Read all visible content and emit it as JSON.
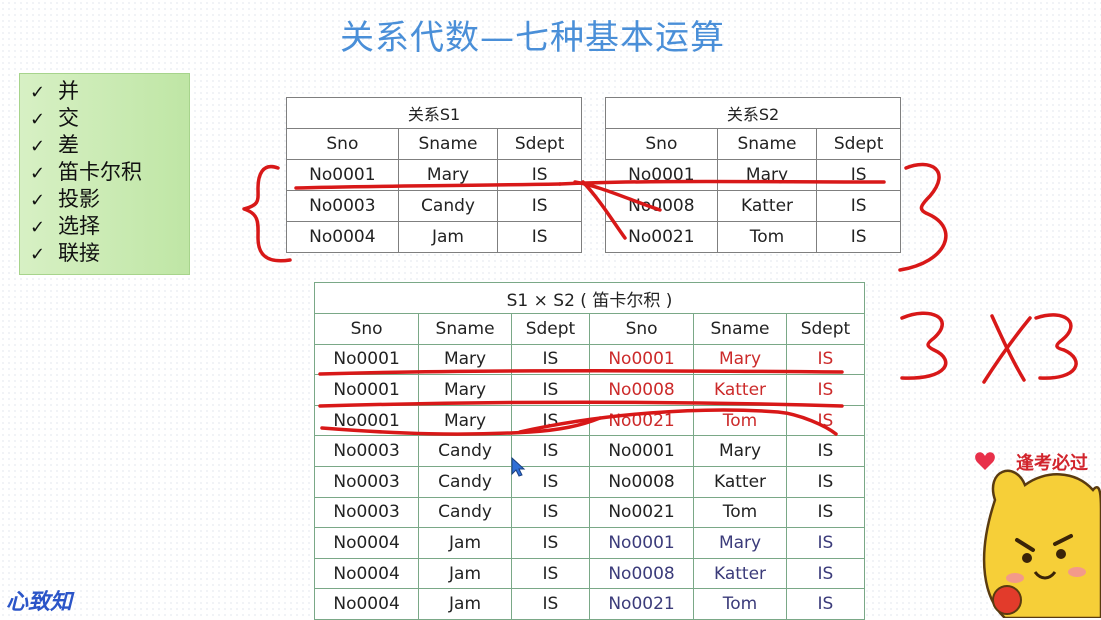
{
  "title": "关系代数—七种基本运算",
  "operations": [
    "并",
    "交",
    "差",
    "笛卡尔积",
    "投影",
    "选择",
    "联接"
  ],
  "s1": {
    "caption": "关系S1",
    "headers": [
      "Sno",
      "Sname",
      "Sdept"
    ],
    "rows": [
      [
        "No0001",
        "Mary",
        "IS"
      ],
      [
        "No0003",
        "Candy",
        "IS"
      ],
      [
        "No0004",
        "Jam",
        "IS"
      ]
    ]
  },
  "s2": {
    "caption": "关系S2",
    "headers": [
      "Sno",
      "Sname",
      "Sdept"
    ],
    "rows": [
      [
        "No0001",
        "Mary",
        "IS"
      ],
      [
        "No0008",
        "Katter",
        "IS"
      ],
      [
        "No0021",
        "Tom",
        "IS"
      ]
    ]
  },
  "product": {
    "caption": "S1 × S2 ( 笛卡尔积 )",
    "headers": [
      "Sno",
      "Sname",
      "Sdept",
      "Sno",
      "Sname",
      "Sdept"
    ],
    "rows": [
      [
        "No0001",
        "Mary",
        "IS",
        "No0001",
        "Mary",
        "IS"
      ],
      [
        "No0001",
        "Mary",
        "IS",
        "No0008",
        "Katter",
        "IS"
      ],
      [
        "No0001",
        "Mary",
        "IS",
        "No0021",
        "Tom",
        "IS"
      ],
      [
        "No0003",
        "Candy",
        "IS",
        "No0001",
        "Mary",
        "IS"
      ],
      [
        "No0003",
        "Candy",
        "IS",
        "No0008",
        "Katter",
        "IS"
      ],
      [
        "No0003",
        "Candy",
        "IS",
        "No0021",
        "Tom",
        "IS"
      ],
      [
        "No0004",
        "Jam",
        "IS",
        "No0001",
        "Mary",
        "IS"
      ],
      [
        "No0004",
        "Jam",
        "IS",
        "No0008",
        "Katter",
        "IS"
      ],
      [
        "No0004",
        "Jam",
        "IS",
        "No0021",
        "Tom",
        "IS"
      ]
    ]
  },
  "annotations": {
    "s2_count": "3",
    "result": "3×3"
  },
  "watermark_left": "心致知",
  "mascot_text": "逢考必过",
  "colors": {
    "title": "#4a8fd8",
    "ink": "#d81818",
    "ops_bg": "#c9ebb2",
    "highlight_text": "#cc2a2a"
  }
}
